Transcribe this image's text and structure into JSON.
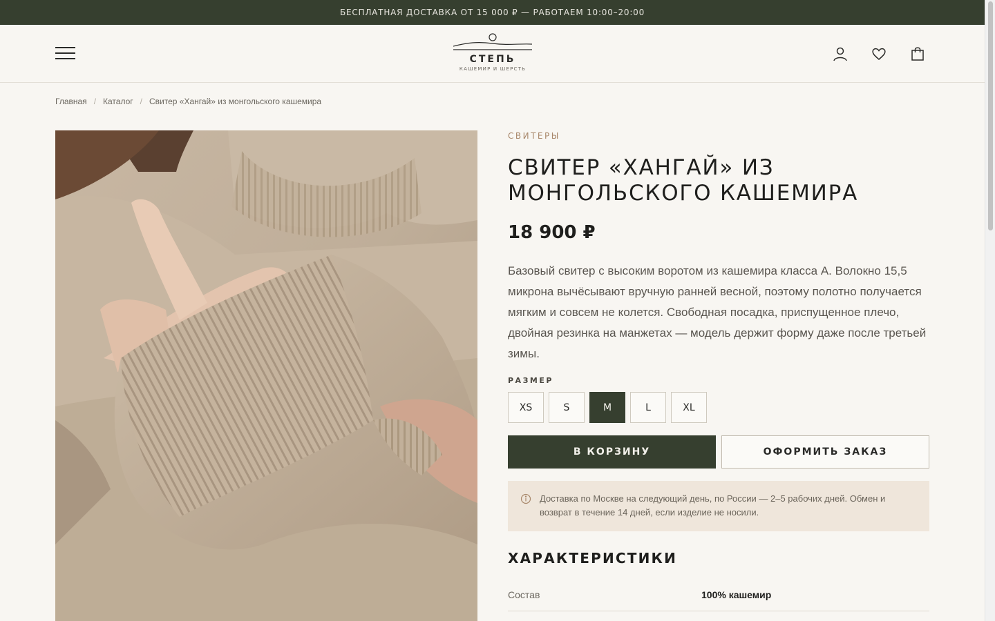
{
  "topbar": {
    "text": "БЕСПЛАТНАЯ ДОСТАВКА ОТ 15 000 ₽ — РАБОТАЕМ 10:00–20:00"
  },
  "header": {
    "logo_name": "СТЕПЬ",
    "logo_sub": "КАШЕМИР И ШЕРСТЬ",
    "icons": [
      "menu-icon",
      "user-icon",
      "heart-icon",
      "bag-icon"
    ]
  },
  "breadcrumb": {
    "items": [
      "Главная",
      "Каталог",
      "Свитер «Хангай» из монгольского кашемира"
    ],
    "separator": "/"
  },
  "product": {
    "category": "СВИТЕРЫ",
    "title": "СВИТЕР «ХАНГАЙ» ИЗ МОНГОЛЬСКОГО КАШЕМИРА",
    "price": "18 900 ₽",
    "description": "Базовый свитер с высоким воротом из кашемира класса А. Волокно 15,5 микрона вычёсывают вручную ранней весной, поэтому полотно получается мягким и совсем не колется. Свободная посадка, приспущенное плечо, двойная резинка на манжетах — модель держит форму даже после третьей зимы.",
    "size_label": "РАЗМЕР",
    "sizes": [
      "XS",
      "S",
      "M",
      "L",
      "XL"
    ],
    "selected_size": "M",
    "add_to_cart": "В КОРЗИНУ",
    "checkout": "ОФОРМИТЬ ЗАКАЗ",
    "notice": "Доставка по Москве на следующий день, по России — 2–5 рабочих дней. Обмен и возврат в течение 14 дней, если изделие не носили.",
    "specs_title": "ХАРАКТЕРИСТИКИ",
    "specs": [
      {
        "key": "Состав",
        "value": "100% кашемир"
      }
    ]
  },
  "colors": {
    "accent": "#363f2f",
    "background": "#f8f6f2",
    "notice_bg": "#efe6db",
    "category": "#a8876a"
  }
}
